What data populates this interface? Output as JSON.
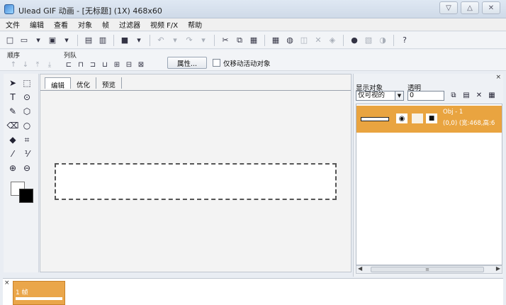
{
  "window": {
    "title": "Ulead GIF 动画 - [无标题] (1X) 468x60",
    "controls": [
      "▽",
      "△",
      "✕"
    ]
  },
  "menu": [
    "文件",
    "编辑",
    "查看",
    "对象",
    "帧",
    "过滤器",
    "视频 F/X",
    "帮助"
  ],
  "toolbar2": {
    "order_label": "顺序",
    "queue_label": "列队",
    "properties_button": "属性...",
    "move_active_only_label": "仅移动活动对象",
    "move_active_only_checked": false
  },
  "work_area": {
    "tabs": [
      "编辑",
      "优化",
      "预览"
    ],
    "active_tab": "编辑"
  },
  "object_panel": {
    "show_objects_label": "显示对象",
    "transparency_label": "透明",
    "show_select_value": "仅可视的",
    "transparency_value": "0",
    "objects": [
      {
        "name": "Obj - 1",
        "info": "(0,0) (宽:468,高:6"
      }
    ]
  },
  "frame_panel": {
    "frames": [
      {
        "label": "1 帧"
      }
    ]
  }
}
